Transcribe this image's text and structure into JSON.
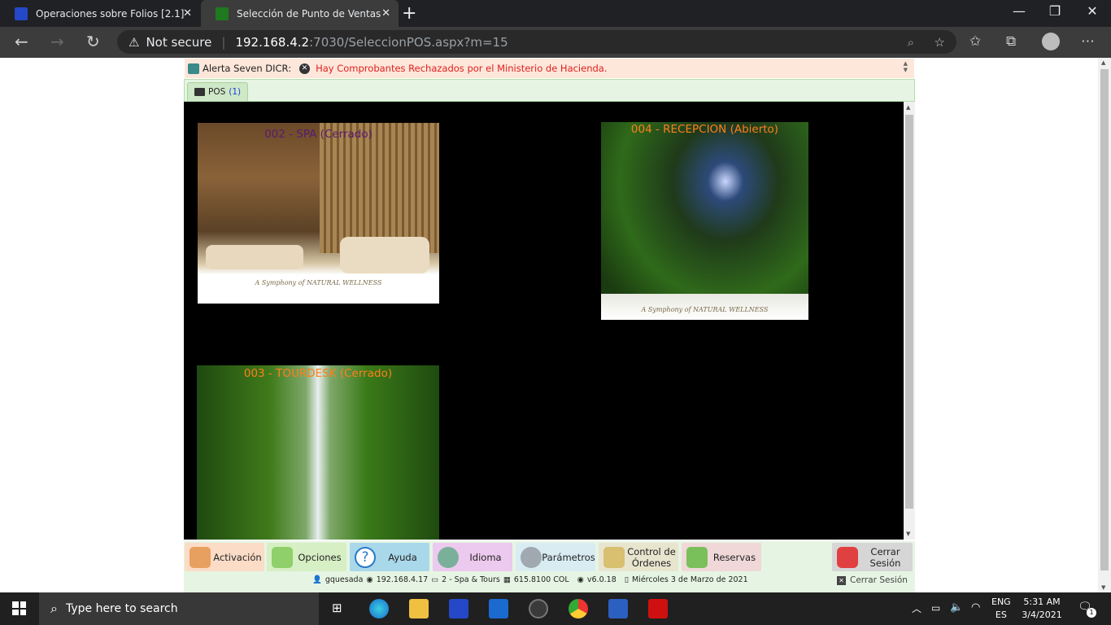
{
  "browser": {
    "tabs": [
      {
        "title": "Operaciones sobre Folios [2.1]",
        "active": false
      },
      {
        "title": "Selección de Punto de Ventas",
        "active": true
      }
    ],
    "security_label": "Not secure",
    "url_host": "192.168.4.2",
    "url_rest": ":7030/SeleccionPOS.aspx?m=15"
  },
  "alert": {
    "label": "Alerta Seven DICR:",
    "message": "Hay Comprobantes Rechazados por el Ministerio de Hacienda."
  },
  "pos_tab": {
    "label": "POS",
    "count": "(1)"
  },
  "pos_cards": [
    {
      "caption": "002 - SPA (Cerrado)",
      "color": "#5a1a6e",
      "footer_text": "A Symphony of NATURAL WELLNESS"
    },
    {
      "caption": "004 - RECEPCION (Abierto)",
      "color": "#ff7f1a",
      "footer_text": "A Symphony of NATURAL WELLNESS"
    },
    {
      "caption": "003 - TOURDESK (Cerrado)",
      "color": "#ff7f1a"
    }
  ],
  "menu": [
    {
      "label": "Activación",
      "bg": "#fbdcc7"
    },
    {
      "label": "Opciones",
      "bg": "#d6efc4"
    },
    {
      "label": "Ayuda",
      "bg": "#a8d8ea"
    },
    {
      "label": "Idioma",
      "bg": "#ecc9ee"
    },
    {
      "label": "Parámetros",
      "bg": "#d8ecf2"
    },
    {
      "label": "Control de Órdenes",
      "bg": "#e8e5cf"
    },
    {
      "label": "Reservas",
      "bg": "#f0d8d8"
    },
    {
      "label": "Cerrar Sesión",
      "bg": "#d6d6d6"
    }
  ],
  "status": {
    "user": "gquesada",
    "ip": "192.168.4.17",
    "company": "2 - Spa & Tours",
    "rate": "615.8100 COL",
    "version": "v6.0.18",
    "date": "Miércoles 3 de Marzo de 2021",
    "logout": "Cerrar Sesión"
  },
  "taskbar": {
    "search_placeholder": "Type here to search",
    "lang_top": "ENG",
    "lang_bottom": "ES",
    "time": "5:31 AM",
    "date": "3/4/2021",
    "notifications": "1"
  }
}
